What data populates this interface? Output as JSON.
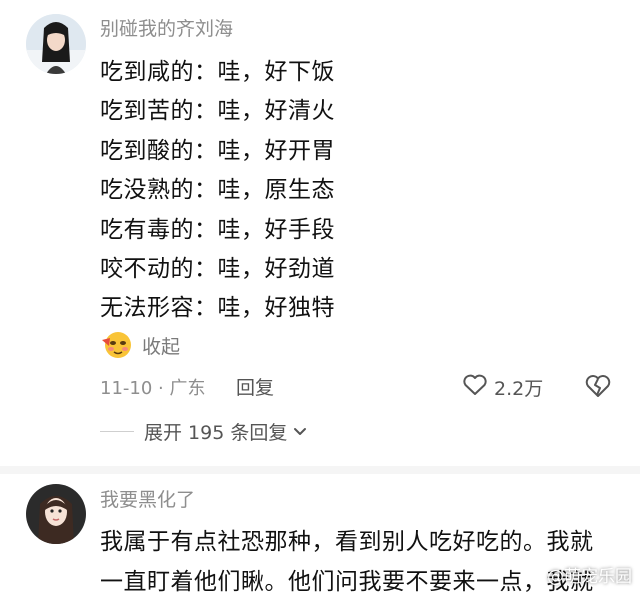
{
  "comments": [
    {
      "username": "别碰我的齐刘海",
      "lines": [
        "吃到咸的：哇，好下饭",
        "吃到苦的：哇，好清火",
        "吃到酸的：哇，好开胃",
        "吃没熟的：哇，原生态",
        "吃有毒的：哇，好手段",
        "咬不动的：哇，好劲道",
        "无法形容：哇，好独特"
      ],
      "collapse_label": "收起",
      "date": "11-10 · 广东",
      "reply_label": "回复",
      "like_count": "2.2万",
      "expand_label": "展开 195 条回复"
    },
    {
      "username": "我要黑化了",
      "lines": [
        "我属于有点社恐那种，看到别人吃好吃的。我就",
        "一直盯着他们瞅。他们问我要不要来一点，我就"
      ]
    }
  ],
  "watermark": "@萌宠乐园",
  "icons": {
    "collapse_emoji": "embarrassed-emoji-icon",
    "like": "heart-outline-icon",
    "dislike": "broken-heart-icon",
    "expand": "chevron-down-icon"
  },
  "colors": {
    "meta_text": "#8e8e8e",
    "body_text": "#111111",
    "divider": "#f5f5f5"
  }
}
